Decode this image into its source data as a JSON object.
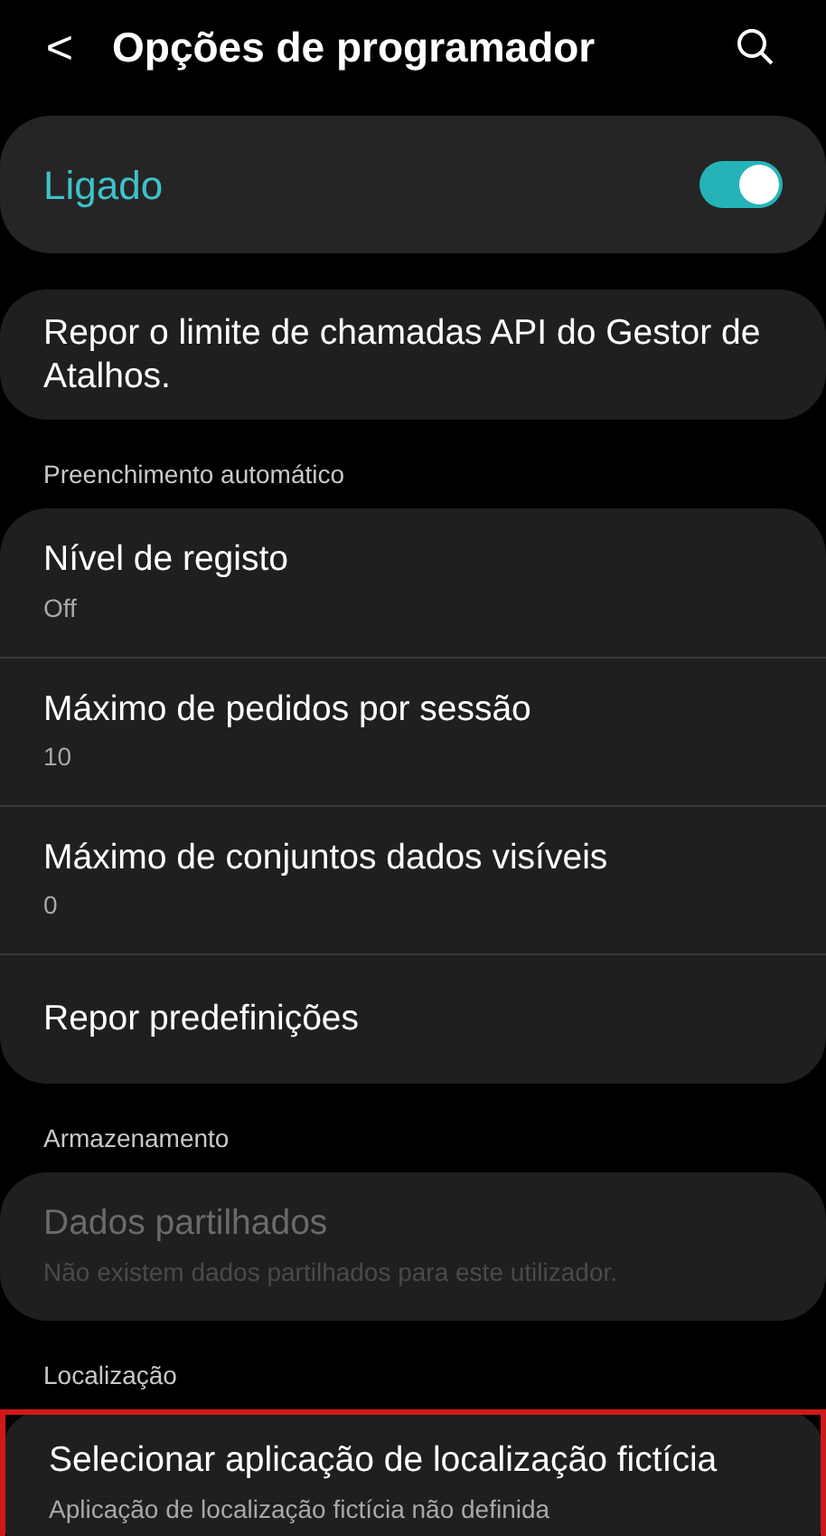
{
  "header": {
    "back": "<",
    "title": "Opções de programador"
  },
  "master": {
    "label": "Ligado",
    "on": true
  },
  "sections": [
    {
      "items": [
        {
          "title": "Repor o limite de chamadas API do Gestor de Atalhos.",
          "disabled": false,
          "highlighted": false
        }
      ]
    },
    {
      "header": "Preenchimento automático",
      "items": [
        {
          "title": "Nível de registo",
          "summary": "Off",
          "disabled": false,
          "highlighted": false
        },
        {
          "title": "Máximo de pedidos por sessão",
          "summary": "10",
          "disabled": false,
          "highlighted": false
        },
        {
          "title": "Máximo de conjuntos dados visíveis",
          "summary": "0",
          "disabled": false,
          "highlighted": false
        },
        {
          "title": "Repor predefinições",
          "disabled": false,
          "highlighted": false
        }
      ]
    },
    {
      "header": "Armazenamento",
      "items": [
        {
          "title": "Dados partilhados",
          "summary": "Não existem dados partilhados para este utilizador.",
          "disabled": true,
          "highlighted": false
        }
      ]
    },
    {
      "header": "Localização",
      "items": [
        {
          "title": "Selecionar aplicação de localização fictícia",
          "summary": "Aplicação de localização fictícia não definida",
          "disabled": false,
          "highlighted": true
        }
      ]
    }
  ]
}
